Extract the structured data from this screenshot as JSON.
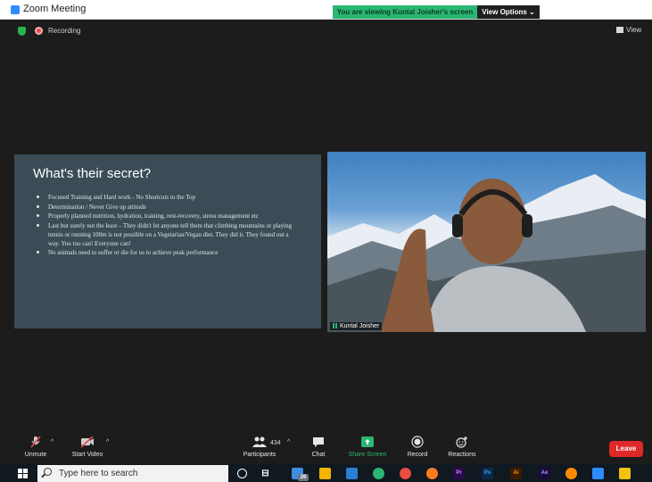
{
  "window": {
    "title": "Zoom Meeting"
  },
  "share_banner": {
    "text": "You are viewing Kuntal Joisher's screen",
    "view_options": "View Options ⌄"
  },
  "status": {
    "recording": "Recording",
    "view": "View"
  },
  "slide": {
    "title": "What's their secret?",
    "bullets": [
      "Focused Training and Hard work - No Shortcuts to the Top",
      "Determination / Never Give up attitude",
      "Properly planned nutrition, hydration, training, rest-recovery, stress management etc",
      "Last but surely not the least – They didn't let anyone tell them that climbing mountains or playing tennis or running 100m is not possible on a Vegetarian/Vegan diet. They did it. They found out a way. You too can! Everyone can!",
      "No animals need to suffer or die for us to achieve peak performance"
    ]
  },
  "video": {
    "participant_name": "Kuntal Joisher"
  },
  "toolbar": {
    "unmute": "Unmute",
    "start_video": "Start Video",
    "participants": "Participants",
    "participant_count": "434",
    "chat": "Chat",
    "share_screen": "Share Screen",
    "record": "Record",
    "reactions": "Reactions",
    "leave": "Leave"
  },
  "taskbar": {
    "search_placeholder": "Type here to search",
    "badge": "26",
    "apps": [
      "Pr",
      "Ps",
      "Ai",
      "Ae"
    ]
  },
  "colors": {
    "accent": "#2d8cff",
    "share_green": "#2bb673",
    "leave_red": "#e02828",
    "slide_bg": "#3b4c56"
  }
}
